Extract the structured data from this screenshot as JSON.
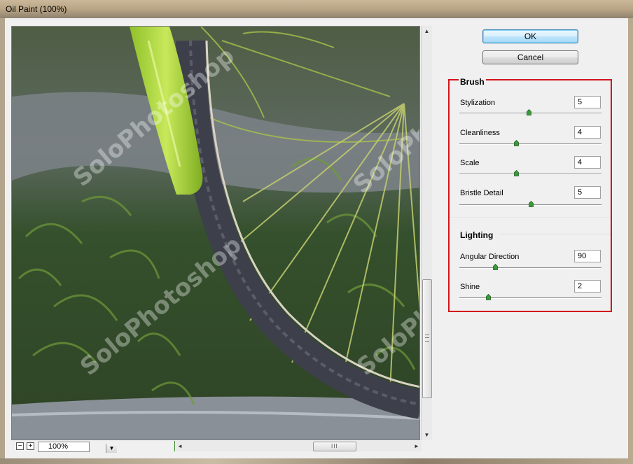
{
  "window": {
    "title": "Oil Paint (100%)"
  },
  "buttons": {
    "ok": "OK",
    "cancel": "Cancel"
  },
  "brush": {
    "heading": "Brush",
    "params": [
      {
        "label": "Stylization",
        "value": "5",
        "level": 0.49
      },
      {
        "label": "Cleanliness",
        "value": "4",
        "level": 0.4
      },
      {
        "label": "Scale",
        "value": "4",
        "level": 0.4
      },
      {
        "label": "Bristle Detail",
        "value": "5",
        "level": 0.5
      }
    ]
  },
  "lighting": {
    "heading": "Lighting",
    "params": [
      {
        "label": "Angular Direction",
        "value": "90",
        "level": 0.25
      },
      {
        "label": "Shine",
        "value": "2",
        "level": 0.2
      }
    ]
  },
  "preview": {
    "watermark": "SoloPhotoshop",
    "zoom": "100%",
    "zoom_out_label": "−",
    "zoom_in_label": "+"
  },
  "colors": {
    "accent_highlight": "#d3141c",
    "default_button": "#3c7fb1"
  }
}
